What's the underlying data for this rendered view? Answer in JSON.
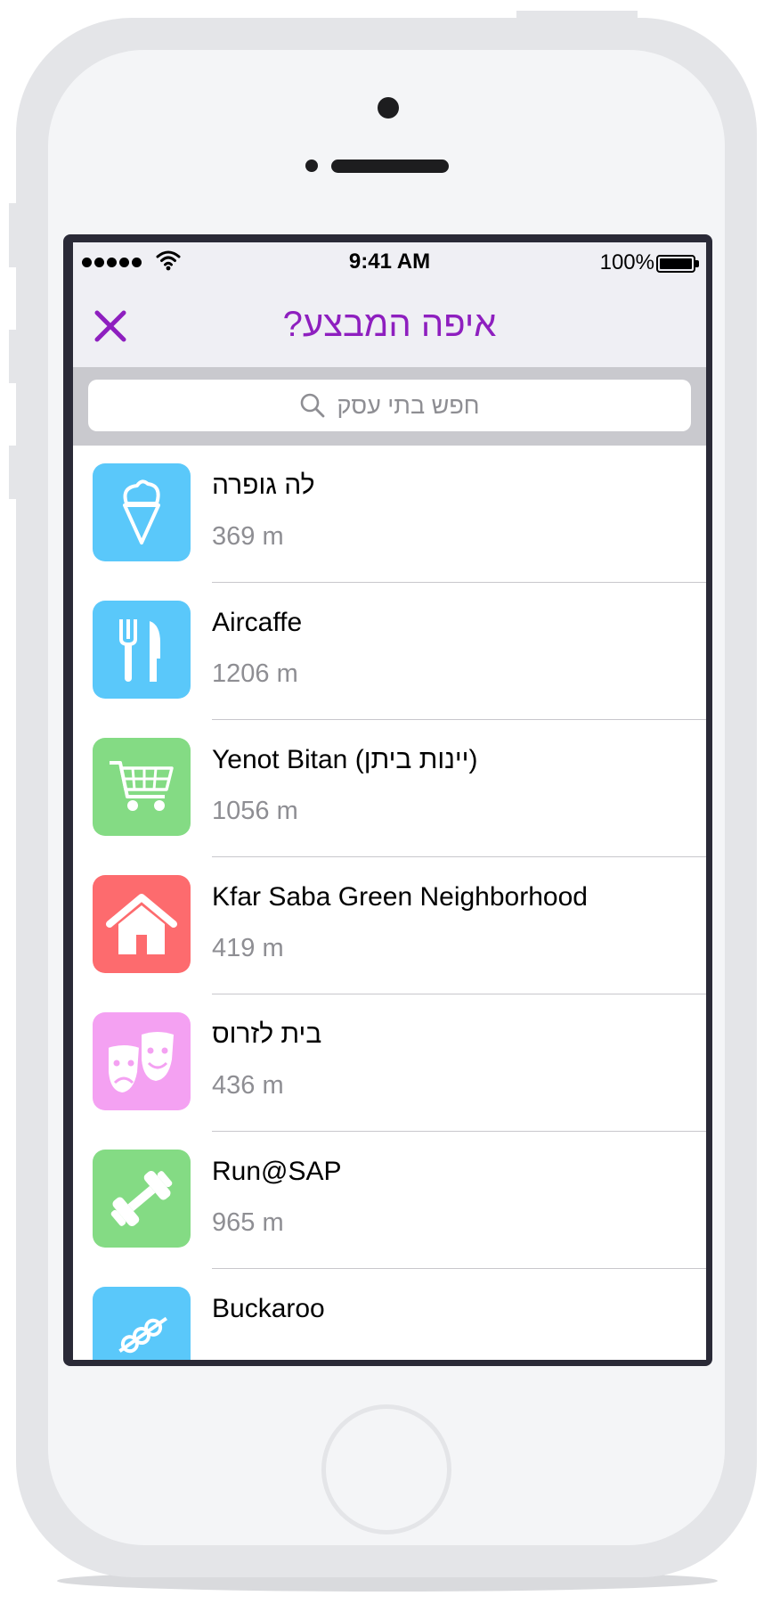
{
  "status_bar": {
    "time": "9:41 AM",
    "battery": "100%"
  },
  "nav": {
    "title": "איפה המבצע?",
    "close_icon": "close-icon"
  },
  "search": {
    "placeholder": "חפש בתי עסק"
  },
  "colors": {
    "accent": "#8e1fbf",
    "blue": "#5ac8fa",
    "green": "#84db84",
    "red": "#fd6b6e",
    "pink": "#f4a1f2"
  },
  "businesses": [
    {
      "name": "לה גופרה",
      "distance": "369 m",
      "icon": "ice-cream-icon",
      "color": "#5ac8fa"
    },
    {
      "name": "Aircaffe",
      "distance": "1206 m",
      "icon": "fork-knife-icon",
      "color": "#5ac8fa"
    },
    {
      "name": "Yenot Bitan (יינות ביתן)",
      "distance": "1056 m",
      "icon": "shopping-cart-icon",
      "color": "#84db84"
    },
    {
      "name": "Kfar Saba Green Neighborhood",
      "distance": "419 m",
      "icon": "house-icon",
      "color": "#fd6b6e"
    },
    {
      "name": "בית לזרוס",
      "distance": "436 m",
      "icon": "theater-masks-icon",
      "color": "#f4a1f2"
    },
    {
      "name": "Run@SAP",
      "distance": "965 m",
      "icon": "dumbbell-icon",
      "color": "#84db84"
    },
    {
      "name": "Buckaroo",
      "distance": "",
      "icon": "skewer-icon",
      "color": "#5ac8fa"
    }
  ]
}
